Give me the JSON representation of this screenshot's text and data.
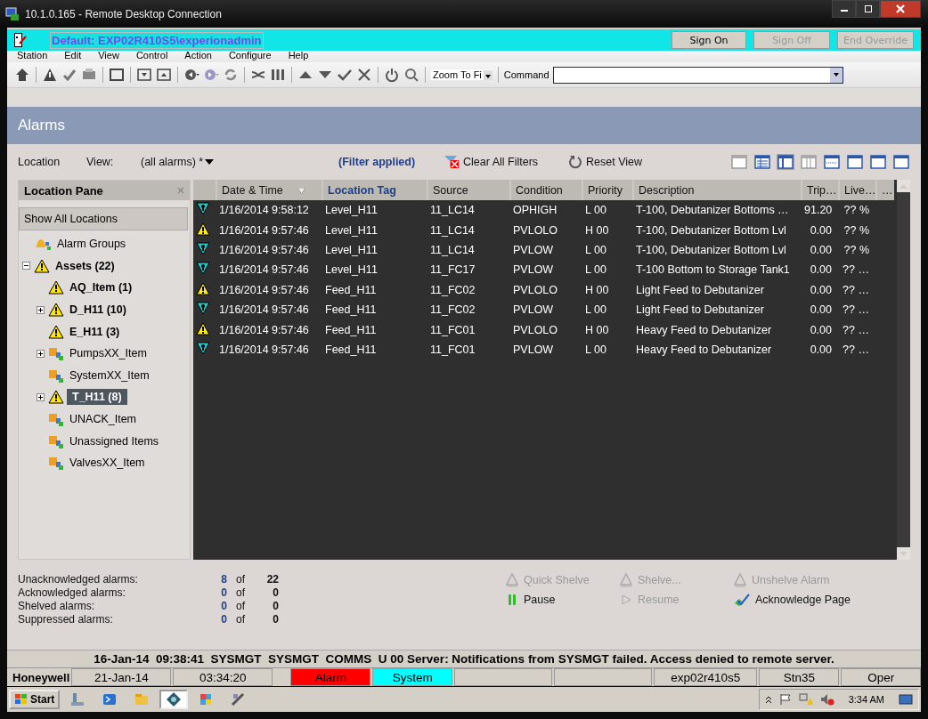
{
  "window": {
    "title": "10.1.0.165 - Remote Desktop Connection"
  },
  "station": {
    "user": "Default: EXP02R410S5\\experionadmin",
    "buttons": [
      {
        "label": "Sign On",
        "disabled": false
      },
      {
        "label": "Sign Off",
        "disabled": true
      },
      {
        "label": "End Override",
        "disabled": true
      }
    ]
  },
  "menu": [
    "Station",
    "Edit",
    "View",
    "Control",
    "Action",
    "Configure",
    "Help"
  ],
  "toolbar": {
    "zoom": "Zoom To Fi",
    "command_label": "Command"
  },
  "page_title": "Alarms",
  "filter_bar": {
    "location_label": "Location",
    "view_label": "View:",
    "view_value": "(all alarms) *",
    "filter_status": "(Filter applied)",
    "actions": [
      "Clear All Filters",
      "Reset View"
    ]
  },
  "location_pane": {
    "title": "Location Pane",
    "show_all": "Show All Locations",
    "tree": [
      {
        "label": "Alarm Groups",
        "kind": "bell",
        "selected": false
      },
      {
        "label": "Assets (22)",
        "kind": "alarm",
        "selected": false,
        "expanded": true,
        "children": [
          {
            "label": "AQ_Item (1)",
            "kind": "alarm",
            "selected": false
          },
          {
            "label": "D_H11 (10)",
            "kind": "alarm",
            "selected": false,
            "expanded": false
          },
          {
            "label": "E_H11 (3)",
            "kind": "alarm",
            "selected": false
          },
          {
            "label": "PumpsXX_Item",
            "kind": "group",
            "selected": false,
            "expanded": false
          },
          {
            "label": "SystemXX_Item",
            "kind": "group",
            "selected": false
          },
          {
            "label": "T_H11 (8)",
            "kind": "alarm",
            "selected": true,
            "expanded": false
          },
          {
            "label": "UNACK_Item",
            "kind": "group",
            "selected": false
          },
          {
            "label": "Unassigned Items",
            "kind": "group",
            "selected": false
          },
          {
            "label": "ValvesXX_Item",
            "kind": "group",
            "selected": false
          }
        ]
      }
    ]
  },
  "table": {
    "columns": [
      {
        "label": "Date & Time",
        "selected": false,
        "sorted": true
      },
      {
        "label": "Location Tag",
        "selected": true
      },
      {
        "label": "Source",
        "selected": false
      },
      {
        "label": "Condition",
        "selected": false
      },
      {
        "label": "Priority",
        "selected": false
      },
      {
        "label": "Description",
        "selected": false
      },
      {
        "label": "Trip…",
        "selected": false
      },
      {
        "label": "Live…",
        "selected": false
      },
      {
        "label": "…",
        "selected": false
      }
    ],
    "rows": [
      {
        "kind": "low",
        "cells": [
          "1/16/2014 9:58:12",
          "Level_H11",
          "11_LC14",
          "OPHIGH",
          "L 00",
          "T-100, Debutanizer Bottoms …",
          "91.20",
          "?? %"
        ]
      },
      {
        "kind": "high",
        "cells": [
          "1/16/2014 9:57:46",
          "Level_H11",
          "11_LC14",
          "PVLOLO",
          "H 00",
          "T-100, Debutanizer Bottom Lvl",
          "0.00",
          "?? %"
        ]
      },
      {
        "kind": "low",
        "cells": [
          "1/16/2014 9:57:46",
          "Level_H11",
          "11_LC14",
          "PVLOW",
          "L 00",
          "T-100, Debutanizer Bottom Lvl",
          "0.00",
          "?? %"
        ]
      },
      {
        "kind": "low",
        "cells": [
          "1/16/2014 9:57:46",
          "Level_H11",
          "11_FC17",
          "PVLOW",
          "L 00",
          "T-100 Bottom to Storage Tank1",
          "0.00",
          "?? …"
        ]
      },
      {
        "kind": "high",
        "cells": [
          "1/16/2014 9:57:46",
          "Feed_H11",
          "11_FC02",
          "PVLOLO",
          "H 00",
          "Light Feed to Debutanizer",
          "0.00",
          "?? …"
        ]
      },
      {
        "kind": "low",
        "cells": [
          "1/16/2014 9:57:46",
          "Feed_H11",
          "11_FC02",
          "PVLOW",
          "L 00",
          "Light Feed to Debutanizer",
          "0.00",
          "?? …"
        ]
      },
      {
        "kind": "high",
        "cells": [
          "1/16/2014 9:57:46",
          "Feed_H11",
          "11_FC01",
          "PVLOLO",
          "H 00",
          "Heavy Feed to Debutanizer",
          "0.00",
          "?? …"
        ]
      },
      {
        "kind": "low",
        "cells": [
          "1/16/2014 9:57:46",
          "Feed_H11",
          "11_FC01",
          "PVLOW",
          "L 00",
          "Heavy Feed to Debutanizer",
          "0.00",
          "?? …"
        ]
      }
    ]
  },
  "counts": [
    {
      "label": "Unacknowledged alarms:",
      "count": "8",
      "of": "of",
      "total": "22"
    },
    {
      "label": "Acknowledged alarms:",
      "count": "0",
      "of": "of",
      "total": "0"
    },
    {
      "label": "Shelved alarms:",
      "count": "0",
      "of": "of",
      "total": "0"
    },
    {
      "label": "Suppressed alarms:",
      "count": "0",
      "of": "of",
      "total": "0"
    }
  ],
  "actions": [
    {
      "label": "Quick Shelve",
      "kind": "shelve",
      "disabled": true
    },
    {
      "label": "Shelve...",
      "kind": "shelve",
      "disabled": true
    },
    {
      "label": "Unshelve Alarm",
      "kind": "shelve",
      "disabled": true
    },
    {
      "label": "Pause",
      "kind": "pause",
      "disabled": false
    },
    {
      "label": "Resume",
      "kind": "resume",
      "disabled": true
    },
    {
      "label": "Acknowledge Page",
      "kind": "acknowledge",
      "disabled": false
    }
  ],
  "message": "16-Jan-14  09:38:41  SYSMGT  SYSMGT  COMMS  U 00 Server: Notifications from SYSMGT failed. Access denied to remote server.",
  "status_bar": {
    "brand": "Honeywell",
    "fields": [
      {
        "kind": "text",
        "text": "21-Jan-14"
      },
      {
        "kind": "text",
        "text": "03:34:20"
      },
      {
        "kind": "indicator",
        "text": "Alarm",
        "color": "#ff0000"
      },
      {
        "kind": "indicator",
        "text": "System",
        "color": "#00ffff"
      },
      {
        "kind": "blank"
      },
      {
        "kind": "blank"
      },
      {
        "kind": "text",
        "text": "exp02r410s5"
      },
      {
        "kind": "text",
        "text": "Stn35"
      },
      {
        "kind": "text",
        "text": "Oper"
      }
    ]
  },
  "taskbar": {
    "start": "Start",
    "apps": [
      {
        "selected": false
      },
      {
        "selected": false
      },
      {
        "selected": false
      },
      {
        "selected": true
      },
      {
        "selected": false
      },
      {
        "selected": false
      }
    ],
    "clock": "3:34 AM"
  }
}
